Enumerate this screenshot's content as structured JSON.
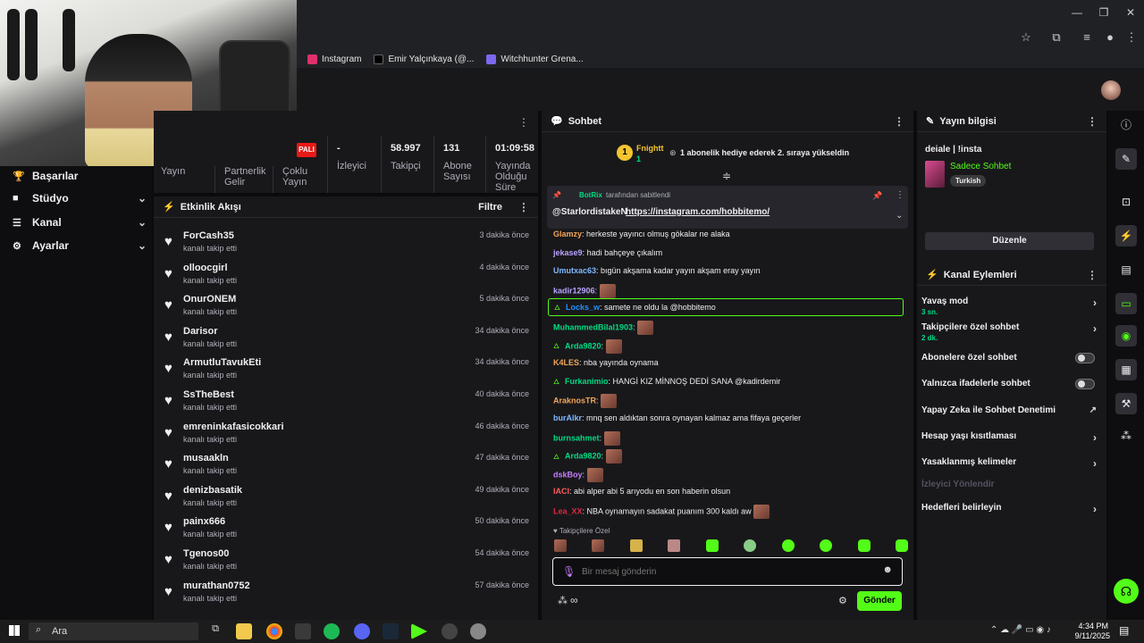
{
  "browser": {
    "window_controls": {
      "minimize": "—",
      "restore": "❐",
      "close": "✕"
    },
    "bookmarks": [
      {
        "label": "Instagram",
        "color": "#e1306c"
      },
      {
        "label": "Emir Yalçınkaya (@...",
        "color": "#000000"
      },
      {
        "label": "Witchhunter Grena...",
        "color": "#7b68ee"
      }
    ]
  },
  "left_nav": {
    "partial_label": "Yayın",
    "items": [
      {
        "label": "Başarılar",
        "icon": "trophy-icon",
        "glyph": "🏆"
      },
      {
        "label": "Stüdyo",
        "icon": "tv-icon",
        "glyph": "■"
      },
      {
        "label": "Kanal",
        "icon": "list-icon",
        "glyph": "☰"
      },
      {
        "label": "Ayarlar",
        "icon": "gear-icon",
        "glyph": "⚙"
      }
    ]
  },
  "stats": {
    "partial_labels": [
      "Partnerlik Gelir",
      "Çoklu Yayın"
    ],
    "badge": "PALI",
    "viewers": {
      "value": "-",
      "label": "İzleyici"
    },
    "followers": {
      "value": "58.997",
      "label": "Takipçi"
    },
    "subs": {
      "value": "131",
      "label": "Abone Sayısı"
    },
    "uptime": {
      "value": "01:09:58",
      "label": "Yayında Olduğu Süre"
    }
  },
  "activity": {
    "title": "Etkinlik Akışı",
    "filter": "Filtre",
    "items": [
      {
        "name": "ForCash35",
        "action": "kanalı takip etti",
        "time": "3 dakika önce"
      },
      {
        "name": "olloocgirl",
        "action": "kanalı takip etti",
        "time": "4 dakika önce"
      },
      {
        "name": "OnurONEM",
        "action": "kanalı takip etti",
        "time": "5 dakika önce"
      },
      {
        "name": "Darisor",
        "action": "kanalı takip etti",
        "time": "34 dakika önce"
      },
      {
        "name": "ArmutluTavukEti",
        "action": "kanalı takip etti",
        "time": "34 dakika önce"
      },
      {
        "name": "SsTheBest",
        "action": "kanalı takip etti",
        "time": "40 dakika önce"
      },
      {
        "name": "emreninkafasicokkari",
        "action": "kanalı takip etti",
        "time": "46 dakika önce"
      },
      {
        "name": "musaakln",
        "action": "kanalı takip etti",
        "time": "47 dakika önce"
      },
      {
        "name": "denizbasatik",
        "action": "kanalı takip etti",
        "time": "49 dakika önce"
      },
      {
        "name": "painx666",
        "action": "kanalı takip etti",
        "time": "50 dakika önce"
      },
      {
        "name": "Tgenos00",
        "action": "kanalı takip etti",
        "time": "54 dakika önce"
      },
      {
        "name": "murathan0752",
        "action": "kanalı takip etti",
        "time": "57 dakika önce"
      }
    ]
  },
  "chat": {
    "title": "Sohbet",
    "gift": {
      "user": "Fnightt",
      "count": "1",
      "rank": "1",
      "text": "1 abonelik hediye ederek 2. sıraya yükseldin"
    },
    "pinned": {
      "by": "BotRix",
      "by_suffix": "tarafından sabitlendi",
      "mention": "@StarlordistakeN",
      "link": "https://instagram.com/hobbitemo/"
    },
    "messages": [
      {
        "user": "Glamzy",
        "color": "#f2a65a",
        "text": "herkeste yayıncı olmuş gökalar ne alaka",
        "emote": false
      },
      {
        "user": "jekase9",
        "color": "#b9a3ff",
        "text": "hadi bahçeye çıkalım",
        "emote": false
      },
      {
        "user": "Umutxac63",
        "color": "#7fb8ff",
        "text": "bıgün akşama kadar yayın akşam eray yayın",
        "emote": false
      },
      {
        "user": "kadir12906",
        "color": "#b9a3ff",
        "text": "",
        "emote": true
      },
      {
        "user": "Locks_w",
        "color": "#1e90ff",
        "text": "samete ne oldu la @hobbitemo",
        "emote": false,
        "highlight": true
      },
      {
        "user": "MuhammedBilal1903",
        "color": "#00db84",
        "text": "",
        "emote": true
      },
      {
        "user": "Arda9820",
        "color": "#00db84",
        "text": "",
        "emote": true,
        "badge": true
      },
      {
        "user": "K4LES",
        "color": "#f2a65a",
        "text": "nba yayında oynama",
        "emote": false
      },
      {
        "user": "Furkanimio",
        "color": "#00db84",
        "text": "HANGİ KIZ MİNNOŞ DEDİ SANA @kadirdemir",
        "emote": false,
        "badge": true
      },
      {
        "user": "AraknosTR",
        "color": "#f2a65a",
        "text": "",
        "emote": true
      },
      {
        "user": "burAlkr",
        "color": "#7fb8ff",
        "text": "mnq sen aldıktan sonra oynayan kalmaz ama fifaya geçerler",
        "emote": false
      },
      {
        "user": "burnsahmet",
        "color": "#00db84",
        "text": "",
        "emote": true
      },
      {
        "user": "Arda9820",
        "color": "#00db84",
        "text": "",
        "emote": true,
        "badge": true
      },
      {
        "user": "dskBoy",
        "color": "#c77dff",
        "text": "",
        "emote": true
      },
      {
        "user": "IACI",
        "color": "#ff5b5b",
        "text": "abi alper abi 5 arıyodu en son haberin olsun",
        "emote": false
      },
      {
        "user": "Lea_XX",
        "color": "#e02640",
        "text": "NBA oynamayın sadakat puanım 300 kaldı aw",
        "emote": true
      }
    ],
    "followers_only": "Takipçilere Özel",
    "input_placeholder": "Bir mesaj gönderin",
    "points": "∞",
    "send": "Gönder"
  },
  "stream_info": {
    "title": "Yayın bilgisi",
    "stream_title": "deiale | !insta",
    "category": "Sadece Sohbet",
    "tag": "Turkish",
    "edit": "Düzenle"
  },
  "channel_actions": {
    "title": "Kanal Eylemleri",
    "items": [
      {
        "label": "Yavaş mod",
        "sub": "3 sn.",
        "control": "arrow"
      },
      {
        "label": "Takipçilere özel sohbet",
        "sub": "2 dk.",
        "control": "arrow"
      },
      {
        "label": "Abonelere özel sohbet",
        "sub": "",
        "control": "toggle"
      },
      {
        "label": "Yalnızca ifadelerle sohbet",
        "sub": "",
        "control": "toggle"
      },
      {
        "label": "Yapay Zeka ile Sohbet Denetimi",
        "sub": "",
        "control": "external"
      },
      {
        "label": "Hesap yaşı kısıtlaması",
        "sub": "",
        "control": "arrow"
      },
      {
        "label": "Yasaklanmış kelimeler",
        "sub": "",
        "control": "arrow"
      },
      {
        "label": "İzleyici Yönlendir",
        "sub": "",
        "control": "none",
        "disabled": true
      },
      {
        "label": "Hedefleri belirleyin",
        "sub": "",
        "control": "arrow"
      }
    ]
  },
  "taskbar": {
    "search": "Ara",
    "time": "4:34 PM",
    "date": "9/11/2025"
  }
}
